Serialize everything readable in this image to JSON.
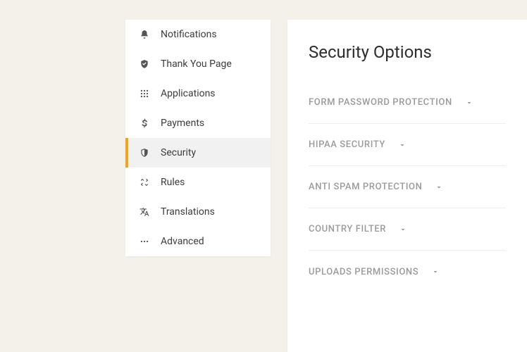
{
  "sidebar": {
    "items": [
      {
        "label": "Notifications",
        "icon": "bell",
        "active": false
      },
      {
        "label": "Thank You Page",
        "icon": "shield-check",
        "active": false
      },
      {
        "label": "Applications",
        "icon": "grid",
        "active": false
      },
      {
        "label": "Payments",
        "icon": "dollar",
        "active": false
      },
      {
        "label": "Security",
        "icon": "shield",
        "active": true
      },
      {
        "label": "Rules",
        "icon": "rules",
        "active": false
      },
      {
        "label": "Translations",
        "icon": "translate",
        "active": false
      },
      {
        "label": "Advanced",
        "icon": "dots",
        "active": false
      }
    ]
  },
  "main": {
    "title": "Security Options",
    "options": [
      {
        "label": "FORM PASSWORD PROTECTION"
      },
      {
        "label": "HIPAA SECURITY"
      },
      {
        "label": "ANTI SPAM PROTECTION"
      },
      {
        "label": "COUNTRY FILTER"
      },
      {
        "label": "UPLOADS PERMISSIONS"
      }
    ]
  }
}
